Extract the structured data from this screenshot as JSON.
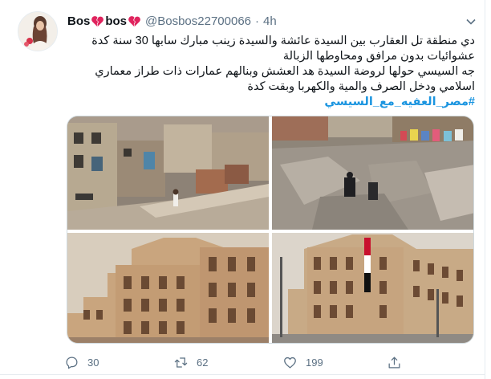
{
  "tweet": {
    "display_name": "Bos💔bos💔",
    "name_part1": "Bos",
    "name_part2": "bos",
    "handle": "@Bosbos22700066",
    "separator": "·",
    "time": "4h",
    "text_lines": [
      "دي منطقة تل العقارب بين السيدة عائشة والسيدة زينب مبارك سابها 30 سنة كدة",
      "عشوائيات بدون مرافق ومحاوطها الزبالة",
      "جه السيسي حولها لروضة السيدة هد العشش وبنالهم عمارات ذات طراز معماري",
      "اسلامي ودخل الصرف والمية والكهربا وبقت كدة"
    ],
    "hashtag": "#مصر_العفيه_مع_السيسي",
    "reply_count": "30",
    "retweet_count": "62",
    "like_count": "199"
  },
  "colors": {
    "accent": "#1b95e0",
    "heart": "#e0245e",
    "muted": "#5b7083"
  },
  "icons": {
    "reply": "reply-icon",
    "retweet": "retweet-icon",
    "like": "like-icon",
    "share": "share-icon",
    "more": "chevron-down-icon"
  }
}
